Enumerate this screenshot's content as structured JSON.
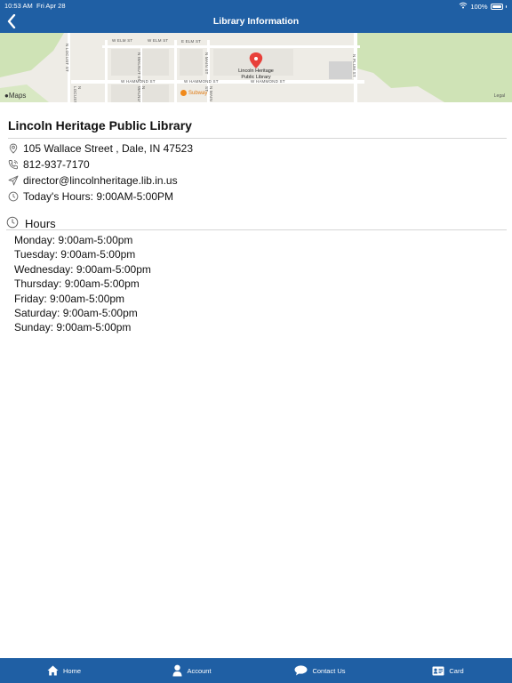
{
  "status_bar": {
    "time": "10:53 AM",
    "date": "Fri Apr 28",
    "battery": "100%"
  },
  "nav": {
    "title": "Library Information"
  },
  "map": {
    "streets": {
      "w_elm_1": "W ELM ST",
      "w_elm_2": "W ELM ST",
      "e_elm": "E ELM ST",
      "w_hammond_1": "W HAMMOND ST",
      "w_hammond_2": "W HAMMOND ST",
      "w_hammond_3": "W HAMMOND ST",
      "n_locust": "N LOCUST ST",
      "n_walnut": "N WALNUT ST",
      "n_main": "N MAIN ST",
      "n_plum": "N PLUM ST",
      "n_walnut_low": "N WALNUT",
      "n_locust_low": "N LOCUST",
      "n_main_low": "N MAIN ST"
    },
    "pin_label_line1": "Lincoln Heritage",
    "pin_label_line2": "Public Library",
    "subway": "Subway",
    "maps_logo": "Maps",
    "legal": "Legal"
  },
  "library": {
    "name": "Lincoln Heritage Public Library",
    "address": "105 Wallace Street , Dale, IN 47523",
    "phone": "812-937-7170",
    "email": "director@lincolnheritage.lib.in.us",
    "today_hours": "Today's Hours: 9:00AM-5:00PM"
  },
  "hours": {
    "heading": "Hours",
    "days": [
      "Monday: 9:00am-5:00pm",
      "Tuesday: 9:00am-5:00pm",
      "Wednesday: 9:00am-5:00pm",
      "Thursday: 9:00am-5:00pm",
      "Friday: 9:00am-5:00pm",
      "Saturday: 9:00am-5:00pm",
      "Sunday: 9:00am-5:00pm"
    ]
  },
  "tabbar": {
    "home": "Home",
    "account": "Account",
    "contact": "Contact Us",
    "card": "Card"
  },
  "colors": {
    "brand_blue": "#1f5fa4",
    "pin_red": "#e8403a",
    "subway_orange": "#f08a1c"
  }
}
